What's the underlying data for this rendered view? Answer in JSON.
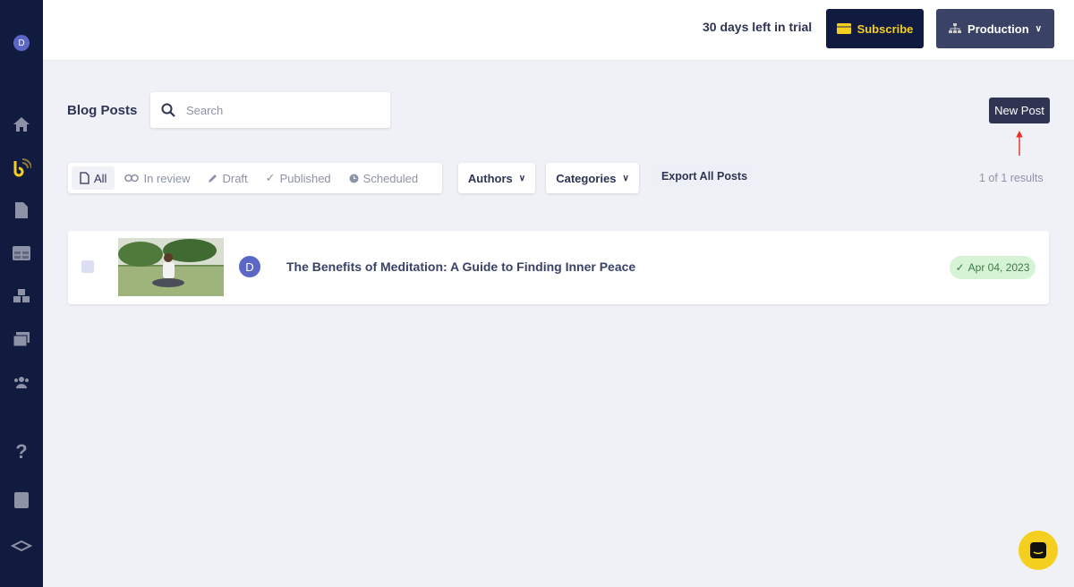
{
  "sidebar": {
    "avatar": "D",
    "icons": [
      "home-icon",
      "blog-icon",
      "page-icon",
      "grid-icon",
      "blocks-icon",
      "media-icon",
      "users-icon",
      "help-icon",
      "book-icon",
      "logo-icon"
    ]
  },
  "topbar": {
    "trial_text": "30 days left in trial",
    "subscribe_label": "Subscribe",
    "environment_label": "Production"
  },
  "main": {
    "title": "Blog Posts",
    "search_placeholder": "Search",
    "new_post_label": "New Post",
    "filters": [
      {
        "label": "All",
        "icon": "file-icon",
        "active": true
      },
      {
        "label": "In review",
        "icon": "glasses-icon"
      },
      {
        "label": "Draft",
        "icon": "pencil-icon"
      },
      {
        "label": "Published",
        "icon": "check-icon"
      },
      {
        "label": "Scheduled",
        "icon": "clock-icon"
      }
    ],
    "authors_label": "Authors",
    "categories_label": "Categories",
    "export_label": "Export All Posts",
    "results": "1 of 1 results",
    "posts": [
      {
        "author_initial": "D",
        "title": "The Benefits of Meditation: A Guide to Finding Inner Peace",
        "status": "published",
        "date": "Apr 04, 2023"
      }
    ]
  },
  "colors": {
    "sidebar": "#111a3f",
    "accent": "#f5cf1f",
    "primary": "#2e3452",
    "success_bg": "#d6f3d6"
  }
}
